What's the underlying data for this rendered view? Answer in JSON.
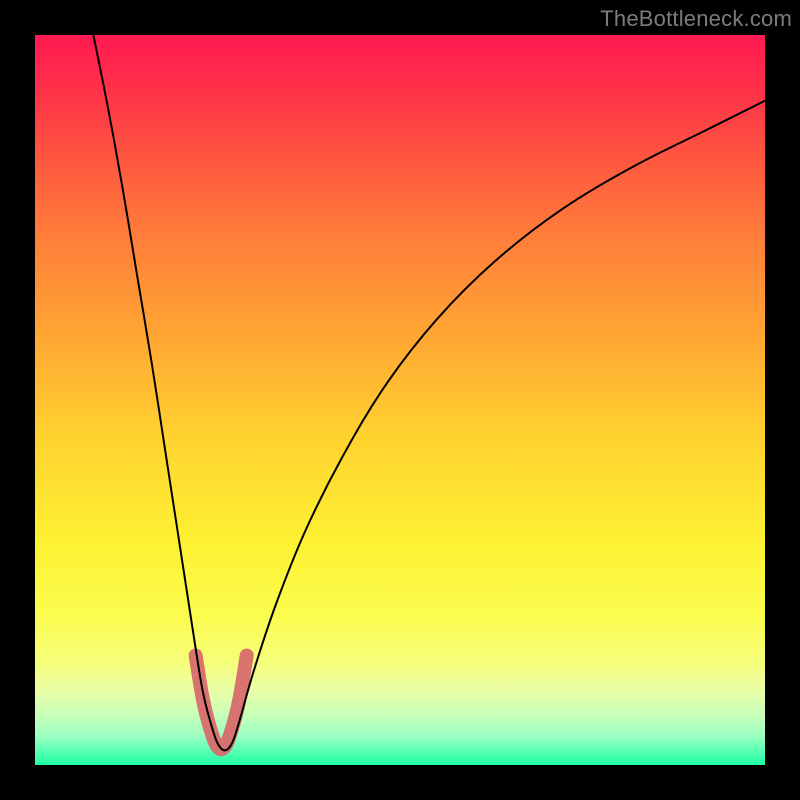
{
  "watermark": "TheBottleneck.com",
  "chart_data": {
    "type": "line",
    "title": "",
    "xlabel": "",
    "ylabel": "",
    "x_range": [
      0,
      100
    ],
    "y_range": [
      0,
      100
    ],
    "background": "rainbow-vertical-gradient",
    "series": [
      {
        "name": "bottleneck-curve",
        "x": [
          8,
          10,
          12,
          14,
          16,
          18,
          20,
          22,
          23,
          24,
          25,
          26,
          27,
          28,
          30,
          33,
          37,
          42,
          48,
          55,
          63,
          72,
          82,
          92,
          100
        ],
        "y": [
          100,
          90,
          79,
          67,
          55,
          42,
          29,
          16,
          10,
          6,
          3,
          2,
          3,
          6,
          13,
          22,
          32,
          42,
          52,
          61,
          69,
          76,
          82,
          87,
          91
        ]
      }
    ],
    "highlight": {
      "name": "optimal-zone",
      "x": [
        22.0,
        23.0,
        24.0,
        25.0,
        26.0,
        27.0,
        28.0,
        29.0
      ],
      "y": [
        15,
        9,
        5,
        2.5,
        2.5,
        5,
        9,
        15
      ]
    },
    "notes": "V-shaped bottleneck curve with minimum approximately at x≈25.5. Highlighted pink segment marks the near-optimal range around the minimum. Values are estimates read from the plot (no axis ticks shown)."
  }
}
